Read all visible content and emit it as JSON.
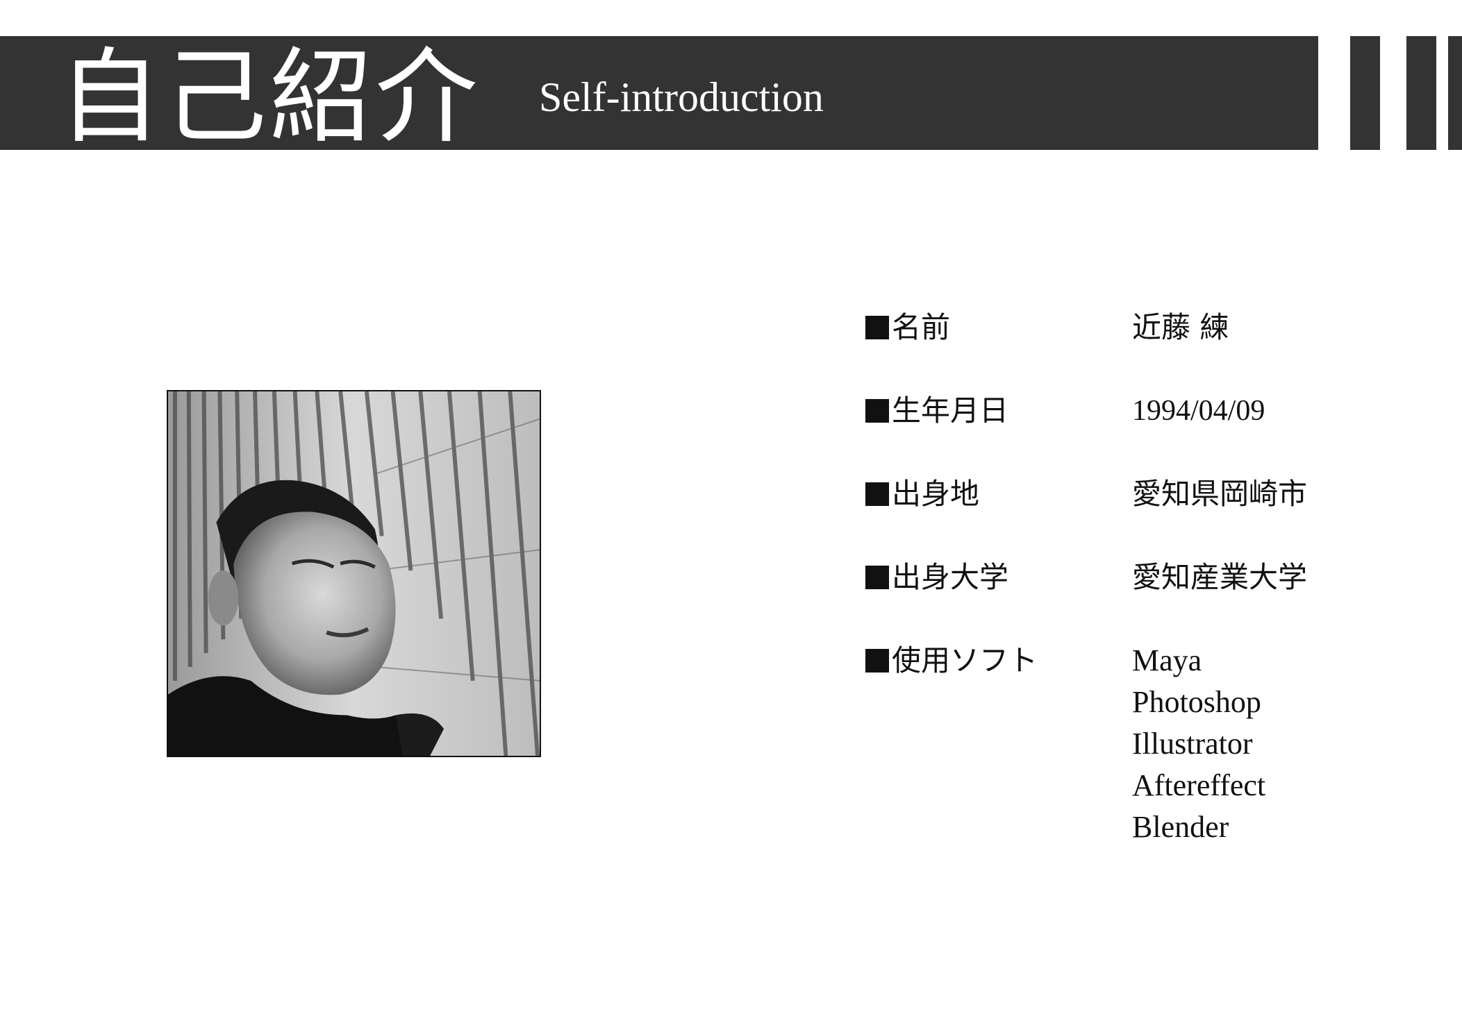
{
  "header": {
    "title_jp": "自己紹介",
    "title_en": "Self-introduction"
  },
  "colors": {
    "header_bg": "#333333",
    "text": "#111111",
    "background": "#ffffff"
  },
  "photo": {
    "description_icon": "portrait-photo"
  },
  "profile": {
    "rows": [
      {
        "label": "名前",
        "value": "近藤 練"
      },
      {
        "label": "生年月日",
        "value": "1994/04/09"
      },
      {
        "label": "出身地",
        "value": "愛知県岡崎市"
      },
      {
        "label": "出身大学",
        "value": "愛知産業大学"
      },
      {
        "label": "使用ソフト"
      }
    ],
    "software": [
      "Maya",
      "Photoshop",
      "Illustrator",
      "Aftereffect",
      "Blender"
    ]
  }
}
